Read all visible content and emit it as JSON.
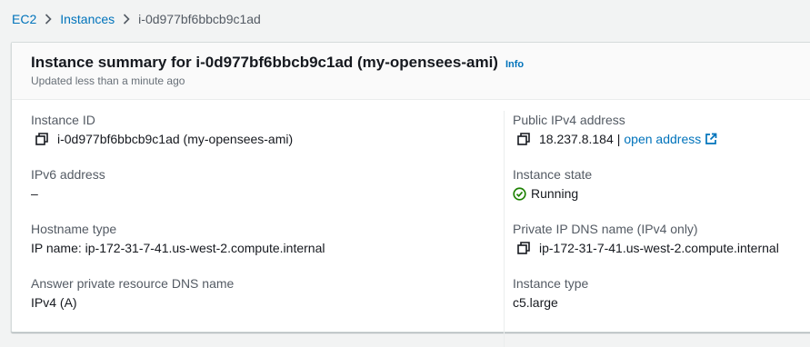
{
  "breadcrumb": {
    "items": [
      {
        "label": "EC2"
      },
      {
        "label": "Instances"
      },
      {
        "label": "i-0d977bf6bbcb9c1ad"
      }
    ]
  },
  "header": {
    "title": "Instance summary for i-0d977bf6bbcb9c1ad (my-opensees-ami)",
    "info_label": "Info",
    "subtitle": "Updated less than a minute ago"
  },
  "left": {
    "instance_id": {
      "label": "Instance ID",
      "value": "i-0d977bf6bbcb9c1ad (my-opensees-ami)"
    },
    "ipv6": {
      "label": "IPv6 address",
      "value": "–"
    },
    "hostname_type": {
      "label": "Hostname type",
      "value": "IP name: ip-172-31-7-41.us-west-2.compute.internal"
    },
    "answer_dns": {
      "label": "Answer private resource DNS name",
      "value": "IPv4 (A)"
    }
  },
  "right": {
    "public_ipv4": {
      "label": "Public IPv4 address",
      "value": "18.237.8.184",
      "separator": "|",
      "link": "open address"
    },
    "instance_state": {
      "label": "Instance state",
      "value": "Running"
    },
    "private_dns": {
      "label": "Private IP DNS name (IPv4 only)",
      "value": "ip-172-31-7-41.us-west-2.compute.internal"
    },
    "instance_type": {
      "label": "Instance type",
      "value": "c5.large"
    }
  },
  "colors": {
    "link": "#0073bb",
    "running": "#1d8102",
    "text": "#16191f",
    "label": "#545b64"
  }
}
